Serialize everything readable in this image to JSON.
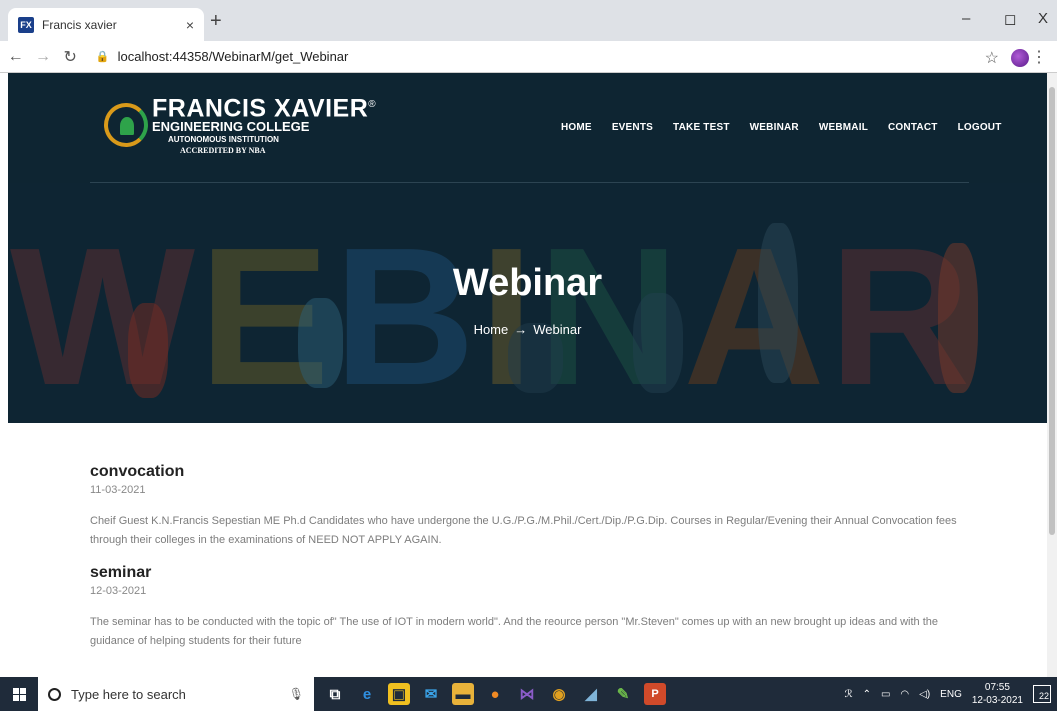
{
  "browser": {
    "tab_title": "Francis xavier",
    "favicon_text": "FX",
    "tab_close": "×",
    "new_tab": "+",
    "url": "localhost:44358/WebinarM/get_Webinar",
    "minimize": "–",
    "restore": "◻",
    "close": "X"
  },
  "site": {
    "logo": {
      "line1": "FRANCIS XAVIER",
      "reg": "®",
      "line2": "ENGINEERING COLLEGE",
      "line3": "AUTONOMOUS INSTITUTION",
      "line4": "ACCREDITED BY NBA"
    },
    "menu": [
      "HOME",
      "EVENTS",
      "TAKE TEST",
      "WEBINAR",
      "WEBMAIL",
      "CONTACT",
      "LOGOUT"
    ],
    "hero": {
      "title": "Webinar",
      "crumb_home": "Home",
      "crumb_arrow": "→",
      "crumb_current": "Webinar",
      "bg_letters": [
        "W",
        "E",
        "B",
        "I",
        "N",
        "A",
        "R"
      ],
      "bg_colors": [
        "#c0392b",
        "#d4a017",
        "#2f7ec4",
        "#e0a020",
        "#2e8b57",
        "#d35400",
        "#c0392b"
      ]
    },
    "entries": [
      {
        "title": "convocation",
        "date": "11-03-2021",
        "body": "Cheif Guest K.N.Francis Sepestian ME Ph.d Candidates who have undergone the U.G./P.G./M.Phil./Cert./Dip./P.G.Dip. Courses in Regular/Evening their Annual Convocation fees through their colleges in the examinations of NEED NOT APPLY AGAIN."
      },
      {
        "title": "seminar",
        "date": "12-03-2021",
        "body": "The seminar has to be conducted with the topic of\" The use of IOT in modern world\". And the reource person \"Mr.Steven\" comes up with an new brought up ideas and with the guidance of helping students for their future"
      }
    ]
  },
  "taskbar": {
    "search_placeholder": "Type here to search",
    "tray_lang": "ENG",
    "time": "07:55",
    "date": "12-03-2021",
    "notifications": "22"
  }
}
